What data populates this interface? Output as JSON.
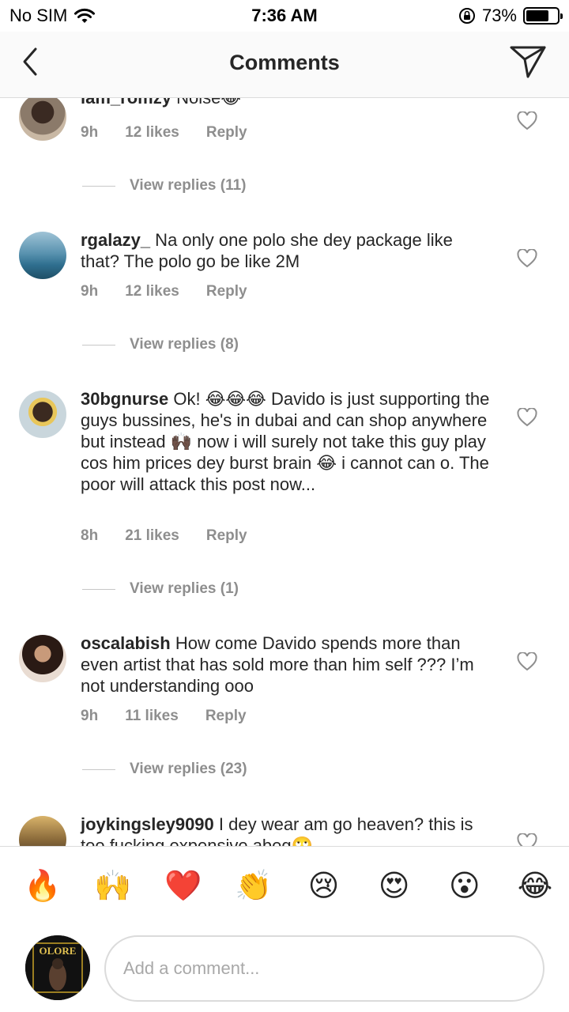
{
  "status_bar": {
    "carrier": "No SIM",
    "time": "7:36 AM",
    "battery": "73%",
    "battery_level": 0.73
  },
  "nav": {
    "title": "Comments"
  },
  "comments": [
    {
      "username": "iam_romzy",
      "text": " Noise😂",
      "time": "9h",
      "likes": "12 likes",
      "reply": "Reply",
      "view_replies": "View replies (11)"
    },
    {
      "username": "rgalazy_",
      "text": " Na only one polo she dey package like that? The polo go be like 2M",
      "time": "9h",
      "likes": "12 likes",
      "reply": "Reply",
      "view_replies": "View replies (8)"
    },
    {
      "username": "30bgnurse",
      "text": " Ok! 😂😂😂 Davido is just supporting the guys bussines, he's in dubai and can shop anywhere but instead 🙌🏿 now i will surely not take this guy play cos him prices dey burst brain 😂 i cannot can o. The poor will attack this post now...",
      "time": "8h",
      "likes": "21 likes",
      "reply": "Reply",
      "view_replies": "View replies (1)"
    },
    {
      "username": "oscalabish",
      "text": " How come Davido spends more than even artist that has sold more than him self ??? I’m not understanding ooo",
      "time": "9h",
      "likes": "11 likes",
      "reply": "Reply",
      "view_replies": "View replies (23)"
    },
    {
      "username": "joykingsley9090",
      "text": " I dey wear am go heaven? this is too fucking expensive abeg🙄"
    }
  ],
  "emoji_bar": [
    "🔥",
    "🙌",
    "❤️",
    "👏",
    "😢",
    "😍",
    "😮",
    "😂"
  ],
  "composer": {
    "placeholder": "Add a comment...",
    "avatar_text": "OLORE"
  }
}
